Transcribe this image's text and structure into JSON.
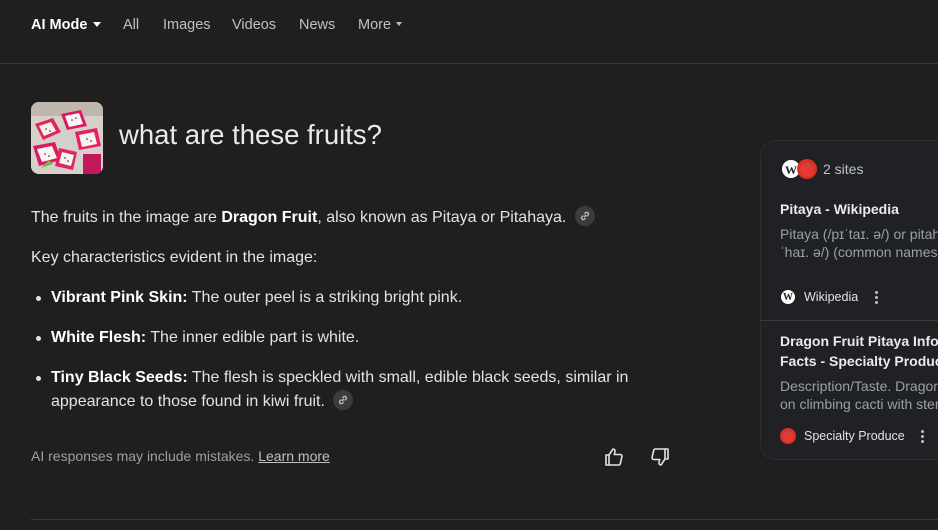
{
  "nav": {
    "tabs": [
      {
        "label": "AI Mode",
        "active": true,
        "dropdown": true
      },
      {
        "label": "All"
      },
      {
        "label": "Images"
      },
      {
        "label": "Videos"
      },
      {
        "label": "News"
      },
      {
        "label": "More",
        "dropdown": true
      }
    ]
  },
  "query": {
    "text": "what are these fruits?",
    "thumbnail": "dragon-fruit-photo"
  },
  "answer": {
    "intro_pre": "The fruits in the image are ",
    "intro_bold": "Dragon Fruit",
    "intro_post": ", also known as Pitaya or Pitahaya.",
    "heading": "Key characteristics evident in the image:",
    "bullets": [
      {
        "bold": "Vibrant Pink Skin:",
        "text": " The outer peel is a striking bright pink."
      },
      {
        "bold": "White Flesh:",
        "text": " The inner edible part is white."
      },
      {
        "bold": "Tiny Black Seeds:",
        "text": " The flesh is speckled with small, edible black seeds, similar in appearance to those found in kiwi fruit."
      }
    ]
  },
  "footer": {
    "disclaimer": "AI responses may include mistakes.",
    "learn_more": "Learn more"
  },
  "sources": {
    "count_label": "2 sites",
    "items": [
      {
        "title": "Pitaya - Wikipedia",
        "snippet_line1": "Pitaya (/pɪˈtaɪ. ə/) or pitahaya (/ˌpɪtə",
        "snippet_line2": "ˈhaɪ. ə/) (common names",
        "site": "Wikipedia",
        "icon": "wikipedia-icon"
      },
      {
        "title_line1": "Dragon Fruit Pitaya Information,",
        "title_line2": "Facts - Specialty Produce",
        "snippet_line1": "Description/Taste. Dragon fruit grow",
        "snippet_line2": "on climbing cacti with stems",
        "site": "Specialty Produce",
        "icon": "specialty-produce-icon"
      }
    ]
  },
  "colors": {
    "background": "#1f1f1f",
    "card": "#202124",
    "text": "#e3e3e3",
    "muted": "#9aa0a6",
    "specialty_produce_red": "#d93025"
  }
}
